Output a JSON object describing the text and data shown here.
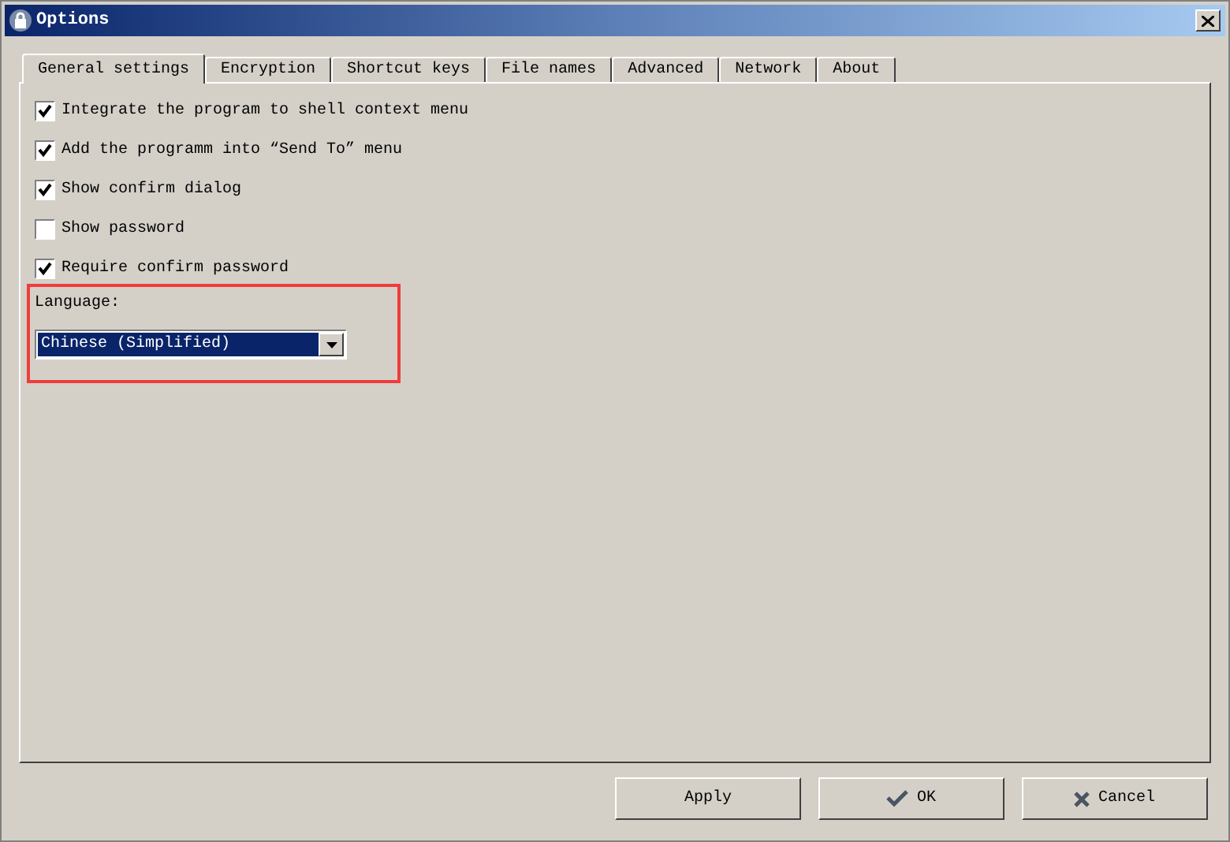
{
  "window": {
    "title": "Options"
  },
  "tabs": [
    {
      "label": "General settings",
      "selected": true
    },
    {
      "label": "Encryption",
      "selected": false
    },
    {
      "label": "Shortcut keys",
      "selected": false
    },
    {
      "label": "File names",
      "selected": false
    },
    {
      "label": "Advanced",
      "selected": false
    },
    {
      "label": "Network",
      "selected": false
    },
    {
      "label": "About",
      "selected": false
    }
  ],
  "options": [
    {
      "label": "Integrate the program to shell context menu",
      "checked": true
    },
    {
      "label": "Add the programm into “Send To” menu",
      "checked": true
    },
    {
      "label": "Show confirm dialog",
      "checked": true
    },
    {
      "label": "Show password",
      "checked": false
    },
    {
      "label": "Require confirm password",
      "checked": true
    }
  ],
  "language": {
    "label": "Language:",
    "value": "Chinese (Simplified)"
  },
  "buttons": [
    {
      "label": "Apply",
      "kind": "plain"
    },
    {
      "label": "OK",
      "kind": "ok"
    },
    {
      "label": "Cancel",
      "kind": "cancel"
    }
  ]
}
